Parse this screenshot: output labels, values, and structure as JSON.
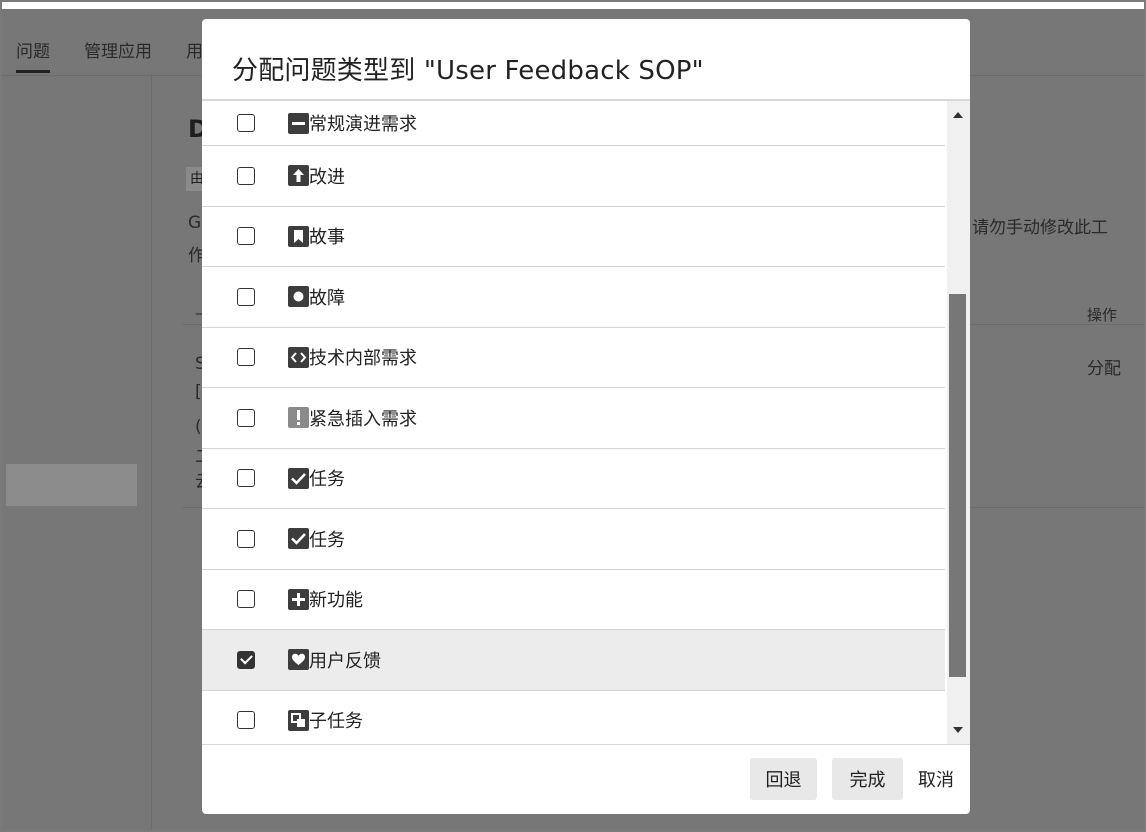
{
  "background": {
    "tabs": [
      "问题",
      "管理应用",
      "用"
    ],
    "title_fragment": "D",
    "badge_fragment": "由",
    "desc_line1_fragment": "G",
    "desc_line2_fragment": "作",
    "desc_right": "请勿手动修改此工",
    "col_header_left": "—",
    "col_header_right": "操作",
    "row_fragments": [
      "S",
      "[",
      "(",
      "二",
      "云"
    ],
    "row_action": "分配"
  },
  "dialog": {
    "title": "分配问题类型到 \"User Feedback SOP\"",
    "items": [
      {
        "label": "常规演进需求",
        "icon": "minus-icon",
        "checked": false
      },
      {
        "label": "改进",
        "icon": "arrow-up-icon",
        "checked": false
      },
      {
        "label": "故事",
        "icon": "bookmark-icon",
        "checked": false
      },
      {
        "label": "故障",
        "icon": "bug-circle-icon",
        "checked": false
      },
      {
        "label": "技术内部需求",
        "icon": "code-icon",
        "checked": false
      },
      {
        "label": "紧急插入需求",
        "icon": "exclamation-icon",
        "checked": false
      },
      {
        "label": "任务",
        "icon": "checkmark-icon",
        "checked": false
      },
      {
        "label": "任务",
        "icon": "checkmark-icon",
        "checked": false
      },
      {
        "label": "新功能",
        "icon": "plus-icon",
        "checked": false
      },
      {
        "label": "用户反馈",
        "icon": "heart-icon",
        "checked": true
      },
      {
        "label": "子任务",
        "icon": "subtask-icon",
        "checked": false
      }
    ],
    "buttons": {
      "back": "回退",
      "done": "完成",
      "cancel": "取消"
    }
  },
  "colors": {
    "overlay": "#777777",
    "dialog": "#ffffff",
    "icon": "#3d3d3d",
    "selected_row": "#ececec"
  }
}
